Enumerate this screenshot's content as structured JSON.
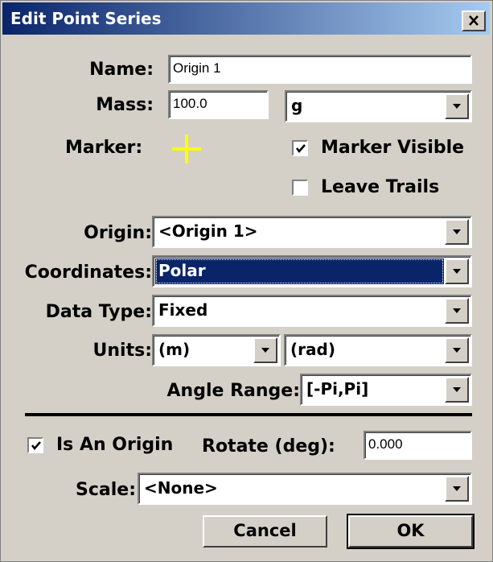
{
  "window": {
    "title": "Edit Point Series"
  },
  "name": {
    "label": "Name:",
    "value": "Origin 1"
  },
  "mass": {
    "label": "Mass:",
    "value": "100.0",
    "unit": "g"
  },
  "marker": {
    "label": "Marker:",
    "color": "#ffff00"
  },
  "marker_visible": {
    "label": "Marker Visible",
    "checked": true
  },
  "leave_trails": {
    "label": "Leave Trails",
    "checked": false
  },
  "origin": {
    "label": "Origin:",
    "value": "<Origin 1>"
  },
  "coordinates": {
    "label": "Coordinates:",
    "value": "Polar"
  },
  "data_type": {
    "label": "Data Type:",
    "value": "Fixed"
  },
  "units": {
    "label": "Units:",
    "length": "(m)",
    "angle": "(rad)"
  },
  "angle_range": {
    "label": "Angle Range:",
    "value": "[-Pi,Pi]"
  },
  "is_origin": {
    "label": "Is An Origin",
    "checked": true
  },
  "rotate": {
    "label": "Rotate (deg):",
    "value": "0.000"
  },
  "scale": {
    "label": "Scale:",
    "value": "<None>"
  },
  "buttons": {
    "cancel": "Cancel",
    "ok": "OK"
  },
  "colors": {
    "title_start": "#0a246a",
    "title_end": "#a6caf0",
    "face": "#d4d0c8",
    "selection": "#0a246a"
  }
}
